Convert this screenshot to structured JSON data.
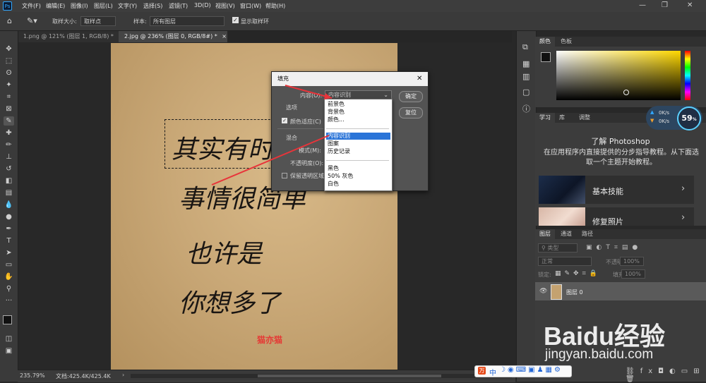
{
  "menubar": {
    "logo": "Ps",
    "items": [
      "文件(F)",
      "编辑(E)",
      "图像(I)",
      "图层(L)",
      "文字(Y)",
      "选择(S)",
      "滤镜(T)",
      "3D(D)",
      "视图(V)",
      "窗口(W)",
      "帮助(H)"
    ]
  },
  "options": {
    "sample_size_label": "取样大小:",
    "sample_size_value": "取样点",
    "sample_label": "样本:",
    "sample_value": "所有图层",
    "show_ring_label": "显示取样环"
  },
  "tabs": [
    {
      "label": "1.png @ 121% (图层 1, RGB/8) *"
    },
    {
      "label": "2.jpg @ 236% (图层 0, RGB/8#) *"
    }
  ],
  "canvas": {
    "lines": [
      "其实有时候",
      "事情很简单",
      "也许是",
      "你想多了"
    ],
    "stamp": "猫亦猫"
  },
  "dialog": {
    "title": "填充",
    "content_label": "内容(O):",
    "content_value": "内容识别",
    "ok_label": "确定",
    "reset_label": "复位",
    "options_label": "选项",
    "color_adapt_label": "颜色适应(C)",
    "blend_label": "混合",
    "mode_label": "模式(M):",
    "opacity_label": "不透明度(O):",
    "preserve_label": "保留透明区域"
  },
  "dropdown": {
    "group1": [
      "前景色",
      "背景色",
      "颜色..."
    ],
    "group2": [
      "内容识别",
      "图案",
      "历史记录"
    ],
    "group3": [
      "黑色",
      "50% 灰色",
      "白色"
    ],
    "selected": "内容识别"
  },
  "statusbar": {
    "zoom": "235.79%",
    "doc": "文档:425.4K/425.4K"
  },
  "color_panel": {
    "tabs": [
      "颜色",
      "色板"
    ]
  },
  "learn_panel": {
    "tabs": [
      "学习",
      "库",
      "调整"
    ],
    "heading": "了解 Photoshop",
    "description": "在应用程序内直接提供的分步指导教程。从下面选取一个主题开始教程。",
    "cards": [
      {
        "label": "基本技能"
      },
      {
        "label": "修复照片"
      }
    ]
  },
  "net_widget": {
    "percent": "59",
    "unit": "%",
    "up": "0K/s",
    "down": "0K/s"
  },
  "layers_panel": {
    "tabs": [
      "图层",
      "通道",
      "路径"
    ],
    "kind_label": "类型",
    "mode_value": "正常",
    "opacity_label": "不透明度:",
    "opacity_value": "100%",
    "lock_label": "锁定:",
    "fill_label": "填充:",
    "fill_value": "100%",
    "layer_name": "图层 0"
  },
  "watermark": {
    "brand": "Baidu经验",
    "url": "jingyan.baidu.com"
  },
  "ime_bar": {
    "label": "中"
  },
  "colors": {
    "accent": "#31a8ff",
    "selection": "#2a74d8",
    "arrow": "#e8343a"
  }
}
